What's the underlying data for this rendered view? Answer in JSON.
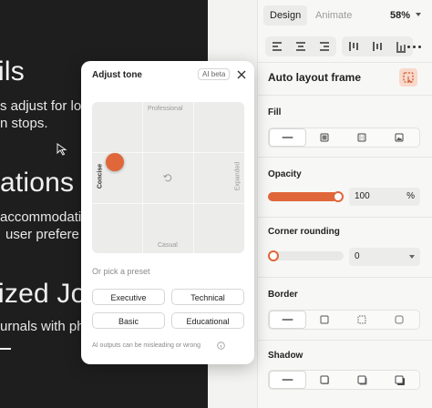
{
  "canvas": {
    "line1": "ils",
    "line2": "s adjust for lo",
    "line3": "n stops.",
    "line4": "ations",
    "line5": "accommodati",
    "line6": "user prefere",
    "line7": "ized Jo",
    "line8": "urnals with pho"
  },
  "panel": {
    "tabs": [
      {
        "label": "Design"
      },
      {
        "label": "Animate"
      }
    ],
    "zoom": "58%",
    "frame_title": "Auto layout frame",
    "fill_label": "Fill",
    "opacity_label": "Opacity",
    "opacity_value": "100",
    "opacity_unit": "%",
    "opacity_fraction": 1.0,
    "corner_label": "Corner rounding",
    "corner_value": "0",
    "border_label": "Border",
    "shadow_label": "Shadow"
  },
  "popover": {
    "title": "Adjust tone",
    "badge": "AI beta",
    "axis_top": "Professional",
    "axis_bottom": "Casual",
    "axis_left": "Concise",
    "axis_right": "Expanded",
    "preset_label": "Or pick a preset",
    "presets": [
      "Executive",
      "Technical",
      "Basic",
      "Educational"
    ],
    "note": "AI outputs can be misleading or wrong"
  },
  "colors": {
    "accent": "#e0673a",
    "canvas": "#1e1e1e",
    "panel": "#f7f7f5"
  },
  "icons": [
    "arrow-cursor-icon",
    "align-left-icon",
    "align-center-icon",
    "align-right-icon",
    "align-top-icon",
    "align-middle-icon",
    "align-bottom-icon",
    "more-icon",
    "auto-layout-icon",
    "solid-fill-icon",
    "image-fill-icon",
    "gradient-fill-icon",
    "video-fill-icon",
    "close-icon",
    "reset-icon",
    "info-icon",
    "border-none-icon",
    "border-solid-icon",
    "border-dashed-icon",
    "border-rounded-icon",
    "shadow-none-icon",
    "shadow-small-icon",
    "shadow-medium-icon",
    "shadow-large-icon"
  ]
}
